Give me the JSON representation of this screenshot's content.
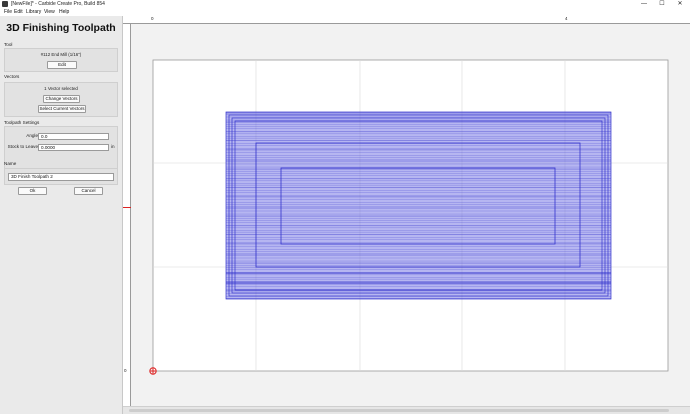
{
  "window": {
    "title": "[NewFile]* - Carbide Create Pro, Build 854",
    "controls": {
      "minimize": "—",
      "maximize": "☐",
      "close": "✕"
    }
  },
  "menu": [
    "File",
    "Edit",
    "Library",
    "View",
    "Help"
  ],
  "panel": {
    "title": "3D Finishing Toolpath",
    "tool": {
      "section_label": "Tool",
      "name": "#112 End Mill (1/16\")",
      "edit_label": "Edit"
    },
    "vectors": {
      "section_label": "Vectors",
      "status": "1 Vector selected",
      "change_label": "Change Vectors",
      "select_current_label": "Select Current Vectors"
    },
    "settings": {
      "section_label": "Toolpath Settings",
      "angle_label": "Angle",
      "angle_value": "0.0",
      "stock_label": "Stock to Leave",
      "stock_value": "0.0000",
      "stock_unit": "in"
    },
    "name": {
      "section_label": "Name",
      "value": "3D Finish Toolpath 2"
    },
    "ok_label": "Ok",
    "cancel_label": "Cancel"
  },
  "ruler": {
    "top_labels": [
      "0",
      "4"
    ],
    "left_labels": [
      "0"
    ]
  },
  "colors": {
    "toolpath": "#3333cc",
    "toolpath_fill": "#7a7ae6",
    "origin_marker": "#dd2222",
    "y_marker": "#dd2222",
    "grid": "#d8d8d8",
    "stock": "#ffffff"
  }
}
